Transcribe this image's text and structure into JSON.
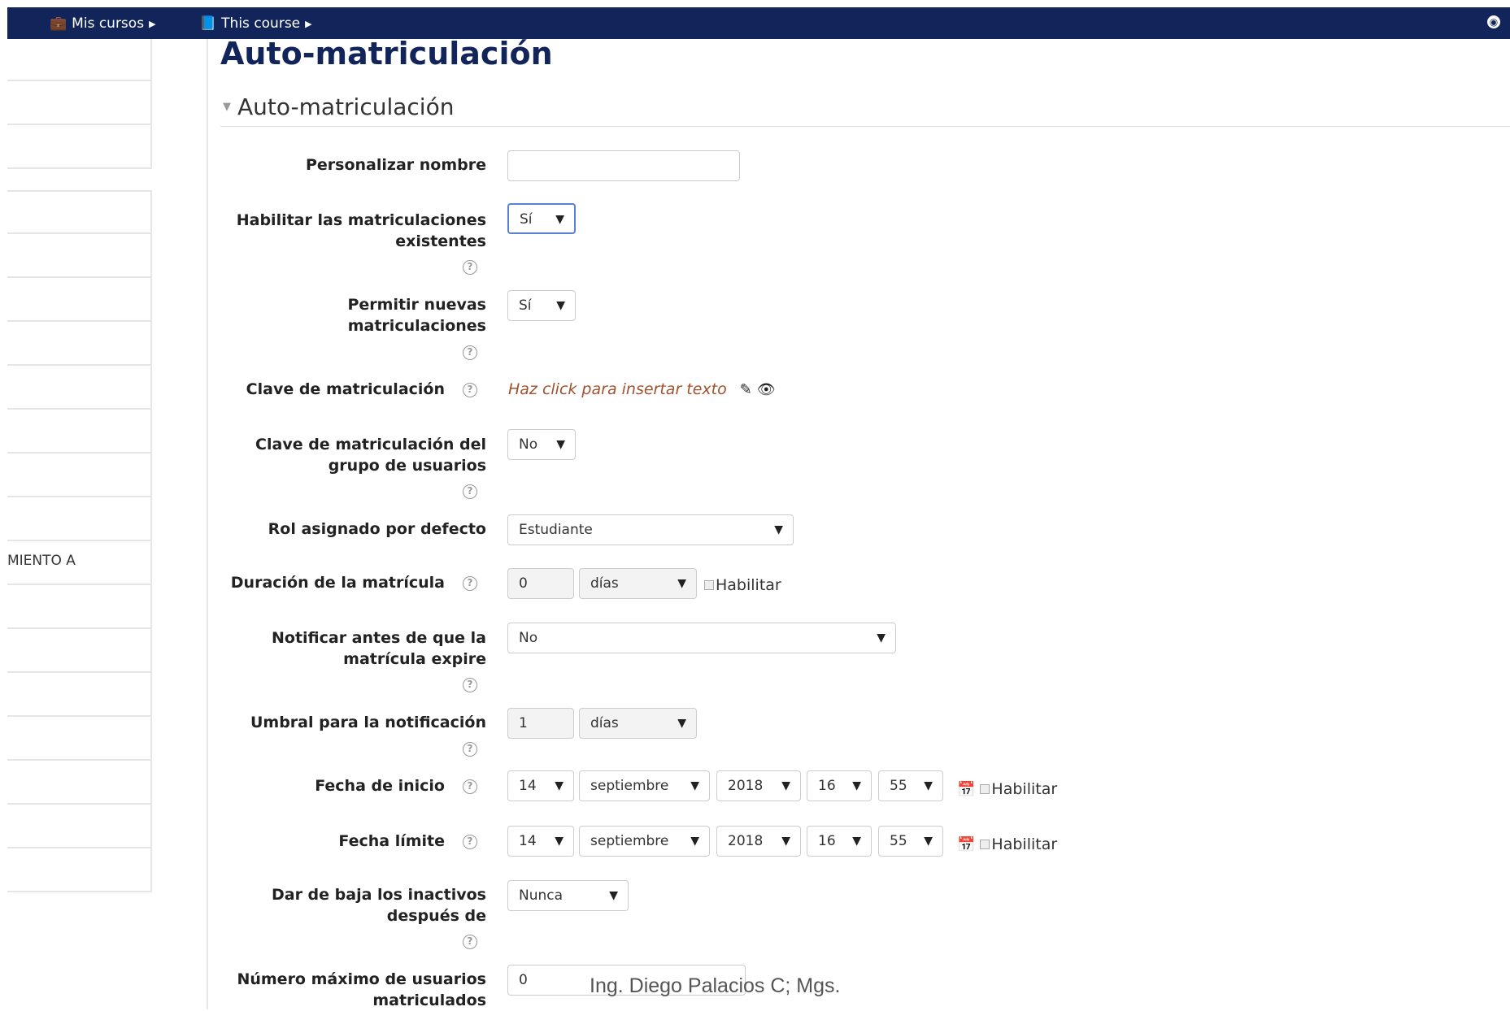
{
  "topbar": {
    "mis_cursos": "Mis cursos",
    "this_course": "This course"
  },
  "sidebar": {
    "item_text": "MIENTO A"
  },
  "page": {
    "title": "Auto-matriculación",
    "section": "Auto-matriculación"
  },
  "form": {
    "personalizar_nombre": {
      "label": "Personalizar nombre",
      "value": ""
    },
    "habilitar_existentes": {
      "label_1": "Habilitar las matriculaciones",
      "label_2": "existentes",
      "value": "Sí"
    },
    "permitir_nuevas": {
      "label_1": "Permitir nuevas",
      "label_2": "matriculaciones",
      "value": "Sí"
    },
    "clave": {
      "label": "Clave de matriculación",
      "placeholder": "Haz click para insertar texto"
    },
    "clave_grupo": {
      "label_1": "Clave de matriculación del",
      "label_2": "grupo de usuarios",
      "value": "No"
    },
    "rol": {
      "label": "Rol asignado por defecto",
      "value": "Estudiante"
    },
    "duracion": {
      "label": "Duración de la matrícula",
      "value": "0",
      "unit": "días",
      "enable": "Habilitar"
    },
    "notificar": {
      "label_1": "Notificar antes de que la",
      "label_2": "matrícula expire",
      "value": "No"
    },
    "umbral": {
      "label": "Umbral para la notificación",
      "value": "1",
      "unit": "días"
    },
    "fecha_inicio": {
      "label": "Fecha de inicio",
      "day": "14",
      "month": "septiembre",
      "year": "2018",
      "hour": "16",
      "minute": "55",
      "enable": "Habilitar"
    },
    "fecha_limite": {
      "label": "Fecha límite",
      "day": "14",
      "month": "septiembre",
      "year": "2018",
      "hour": "16",
      "minute": "55",
      "enable": "Habilitar"
    },
    "dar_de_baja": {
      "label_1": "Dar de baja los inactivos",
      "label_2": "después de",
      "value": "Nunca"
    },
    "max_usuarios": {
      "label_1": "Número máximo de usuarios",
      "label_2": "matriculados",
      "value": "0"
    }
  },
  "footer": {
    "text": "Ing. Diego Palacios C; Mgs."
  }
}
